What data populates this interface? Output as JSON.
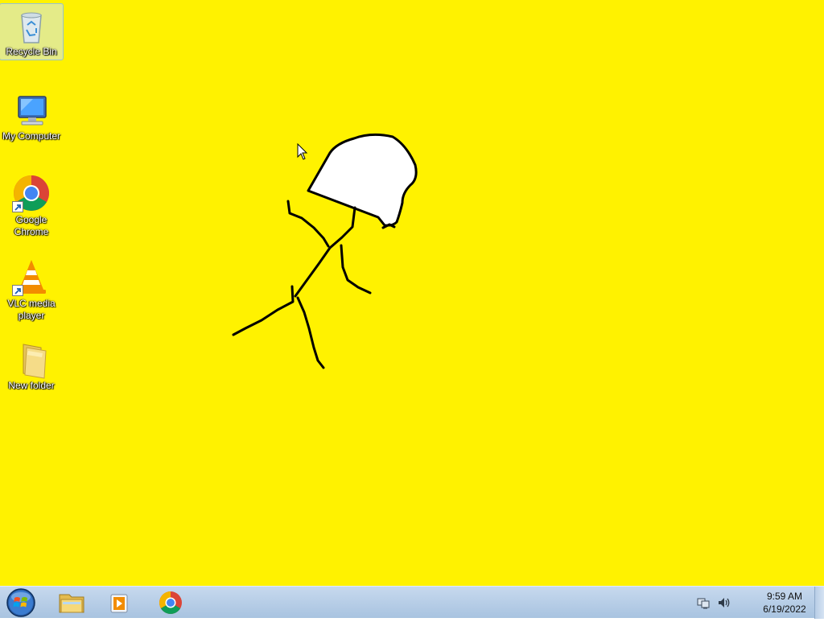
{
  "desktop": {
    "background_color": "#fff200",
    "icons": [
      {
        "label": "Recycle Bin",
        "icon": "recycle-bin-icon",
        "selected": true
      },
      {
        "label": "My Computer",
        "icon": "computer-icon"
      },
      {
        "label": "Google Chrome",
        "icon": "chrome-icon",
        "shortcut": true
      },
      {
        "label": "VLC media player",
        "icon": "vlc-icon",
        "shortcut": true
      },
      {
        "label": "New folder",
        "icon": "folder-icon"
      }
    ]
  },
  "taskbar": {
    "start": "start-orb-icon",
    "pinned": [
      "file-explorer-icon",
      "media-player-icon",
      "chrome-icon"
    ],
    "tray": {
      "icons": [
        "network-icon",
        "volume-icon"
      ],
      "time": "9:59 AM",
      "date": "6/19/2022"
    }
  }
}
